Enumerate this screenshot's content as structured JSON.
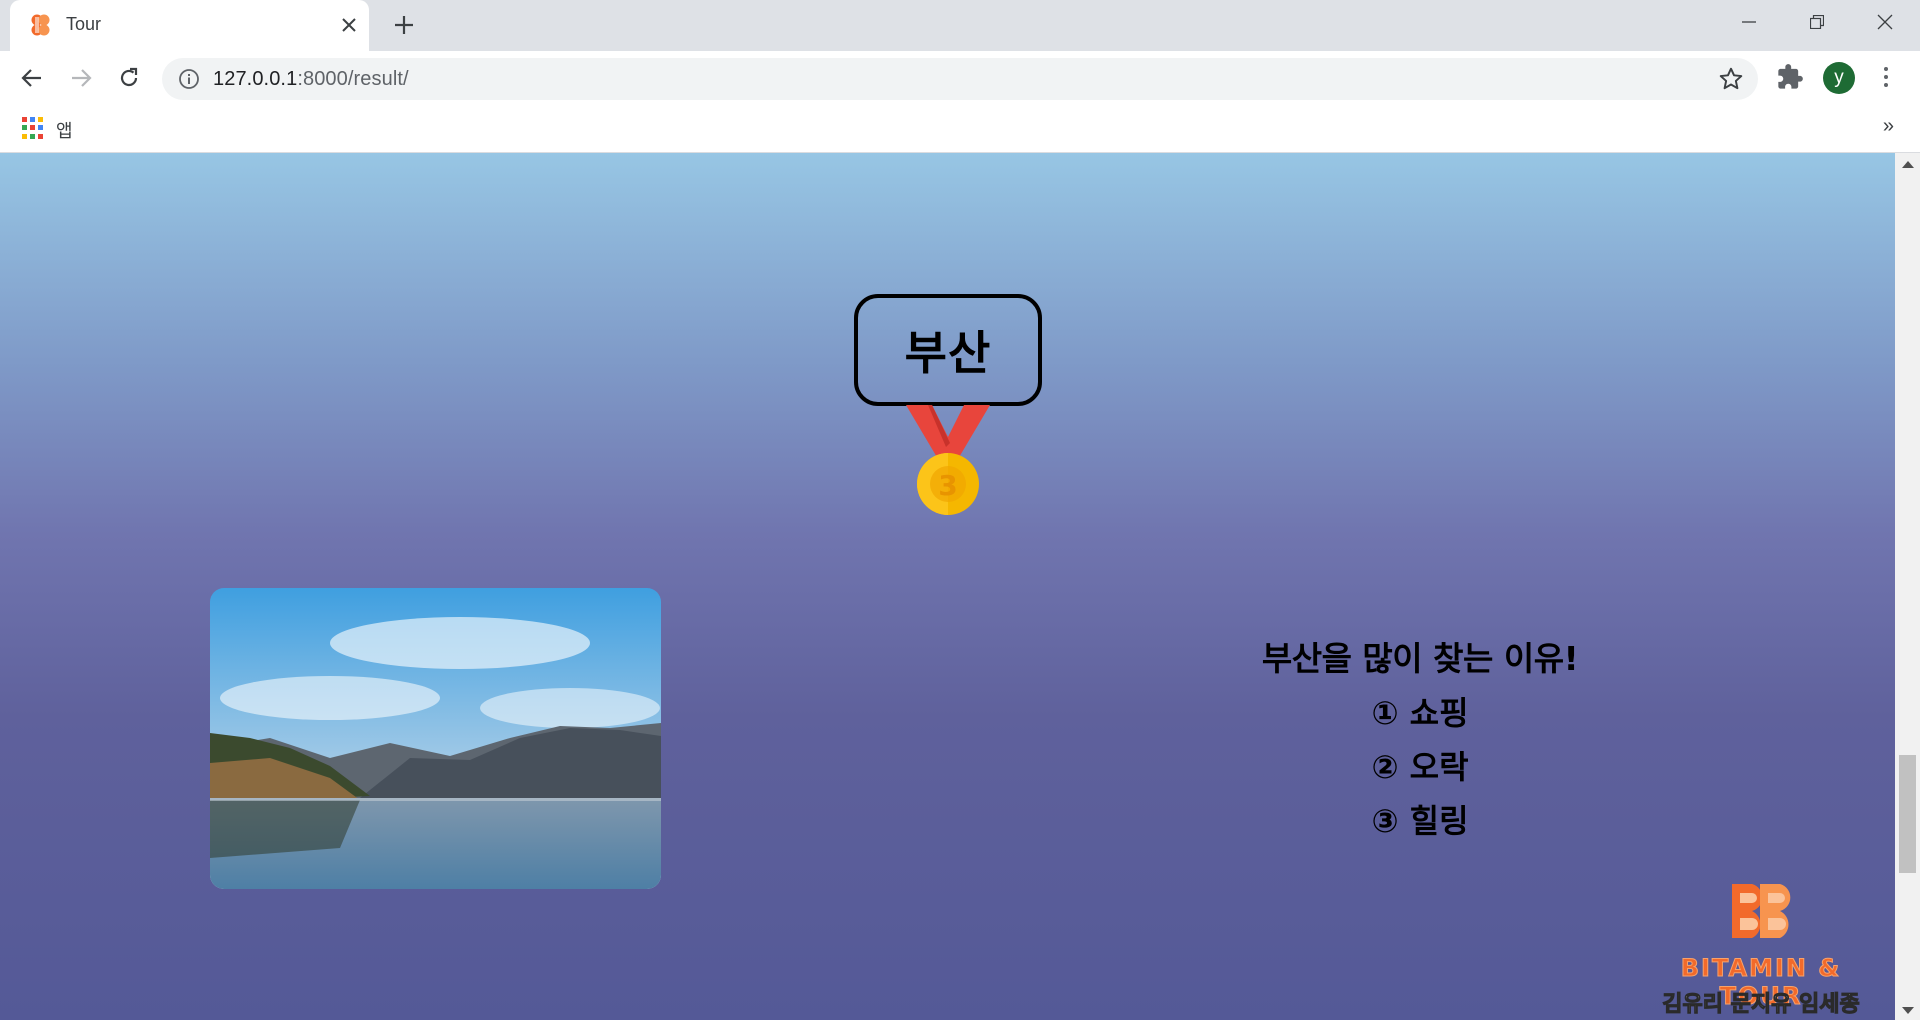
{
  "browser": {
    "tab": {
      "title": "Tour",
      "favicon": "bitamin-logo-icon",
      "close_icon": "close-icon"
    },
    "new_tab_icon": "plus-icon",
    "window_controls": [
      "minimize-icon",
      "restore-icon",
      "close-icon"
    ],
    "toolbar": {
      "back_icon": "arrow-left-icon",
      "forward_icon": "arrow-right-icon",
      "reload_icon": "reload-icon",
      "site_info_icon": "info-icon",
      "url_host": "127.0.0.1",
      "url_path": ":8000/result/",
      "bookmark_icon": "star-icon",
      "extensions_icon": "puzzle-icon",
      "profile_initial": "y",
      "menu_icon": "more-vert-icon"
    },
    "bookmarks_bar": {
      "apps_label": "앱",
      "more_label": "»"
    }
  },
  "page": {
    "city": "부산",
    "medal_number": "3",
    "reasons_title": "부산을 많이 찾는 이유!",
    "reasons": [
      "① 쇼핑",
      "② 오락",
      "③ 힐링"
    ],
    "logo": {
      "brand": "BITAMIN & TOUR",
      "names": "김유리 문지유 임세종"
    }
  },
  "colors": {
    "gradient_top": "#97c6e4",
    "gradient_bottom": "#545997",
    "medal_ribbon": "#e8453c",
    "medal_gold": "#f5b700",
    "logo_orange": "#f26a2b",
    "profile_green": "#1e6b34"
  }
}
